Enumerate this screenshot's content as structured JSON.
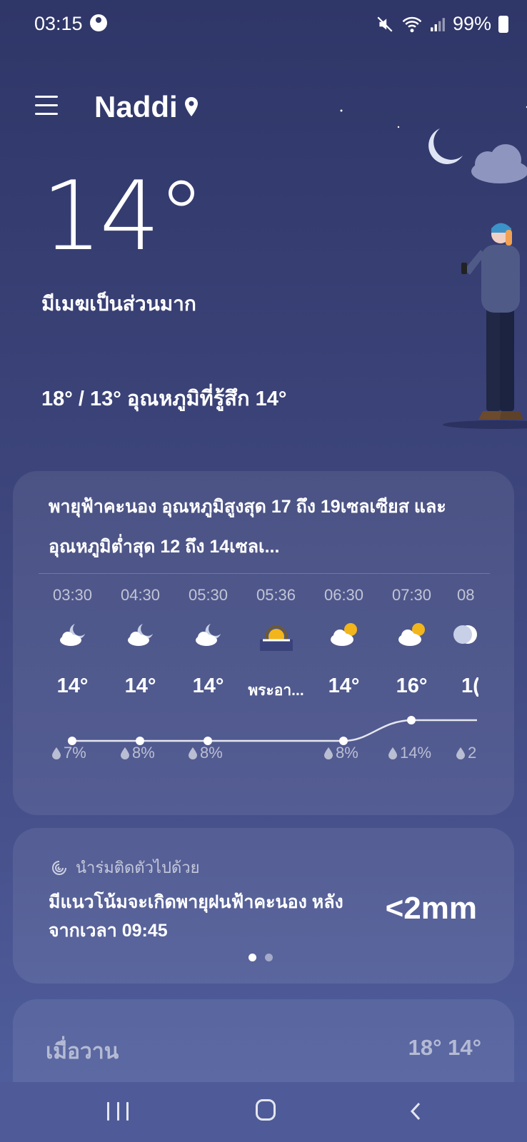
{
  "status_bar": {
    "time": "03:15",
    "battery": "99%",
    "icons": [
      "account-circle-icon",
      "mute-icon",
      "wifi-icon",
      "signal-icon",
      "battery-icon"
    ]
  },
  "header": {
    "location": "Naddi"
  },
  "current": {
    "temperature": "14°",
    "condition": "มีเมฆเป็นส่วนมาก",
    "hilo_feels": "18° / 13° อุณหภูมิที่รู้สึก 14°"
  },
  "forecast": {
    "summary": "พายุฟ้าคะนอง อุณหภูมิสูงสุด 17 ถึง 19เซลเซียส และ อุณหภูมิต่ำสุด 12 ถึง 14เซลเ...",
    "hours": [
      {
        "time": "03:30",
        "icon": "night-cloud-icon",
        "temp": "14°",
        "precip": "7%"
      },
      {
        "time": "04:30",
        "icon": "night-cloud-icon",
        "temp": "14°",
        "precip": "8%"
      },
      {
        "time": "05:30",
        "icon": "night-cloud-icon",
        "temp": "14°",
        "precip": "8%"
      },
      {
        "time": "05:36",
        "icon": "sunrise-icon",
        "temp": "พระอา...",
        "precip": ""
      },
      {
        "time": "06:30",
        "icon": "day-cloud-icon",
        "temp": "14°",
        "precip": "8%"
      },
      {
        "time": "07:30",
        "icon": "day-cloud-icon",
        "temp": "16°",
        "precip": "14%"
      },
      {
        "time": "08",
        "icon": "partial-icon",
        "temp": "1(",
        "precip": "2"
      }
    ],
    "temps_numeric": [
      14,
      14,
      14,
      null,
      14,
      16,
      16
    ]
  },
  "rain_card": {
    "label": "นำร่มติดตัวไปด้วย",
    "text": "มีแนวโน้มจะเกิดพายุฝนฟ้าคะนอง หลังจากเวลา 09:45",
    "amount": "<2mm"
  },
  "yesterday": {
    "label": "เมื่อวาน",
    "temps": "18° 14°"
  },
  "colors": {
    "bg_top": "#2f3668",
    "bg_bottom": "#5160a0",
    "sun": "#f2b51c"
  }
}
